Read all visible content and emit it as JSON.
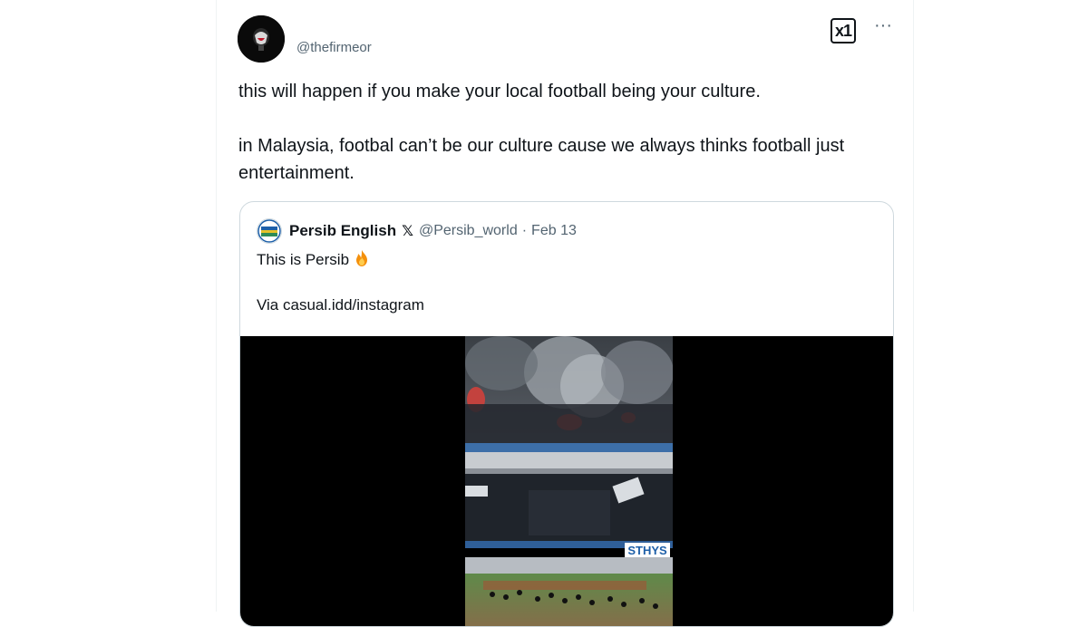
{
  "tweet": {
    "handle": "@thefirmeor",
    "text_line1": "this will happen if you make your local football being your culture.",
    "text_line2": "in Malaysia, footbal can’t be our culture cause we always thinks football just entertainment."
  },
  "toolbar": {
    "x_logo_label": "x1",
    "more_label": "···"
  },
  "quote": {
    "name": "Persib English",
    "verified_glyph": "𝕏",
    "handle": "@Persib_world",
    "separator": "·",
    "date": "Feb 13",
    "text_line1": "This is Persib",
    "text_line2": "Via casual.idd/instagram"
  },
  "media": {
    "banner_text": "STHYS"
  },
  "colors": {
    "text": "#0f1419",
    "secondary": "#536471",
    "border": "#cfd9de",
    "persib_blue": "#1d5fa8"
  }
}
